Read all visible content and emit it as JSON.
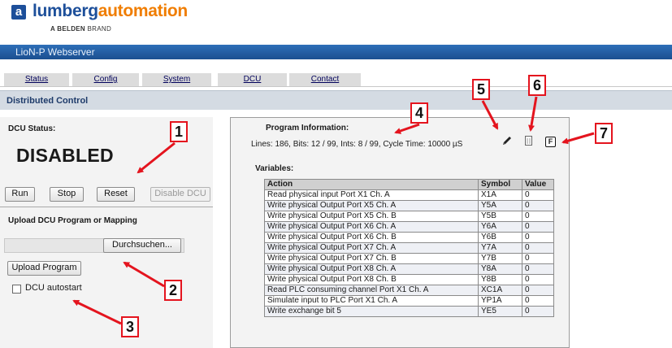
{
  "header": {
    "logo_letter": "a",
    "brand_part1": "lumberg",
    "brand_part2": "automation",
    "tagline_bold": "A BELDEN",
    "tagline_rest": " BRAND",
    "window_title": "LioN-P Webserver"
  },
  "nav": {
    "tabs": [
      {
        "label": "Status"
      },
      {
        "label": "Config"
      },
      {
        "label": "System"
      },
      {
        "label": "DCU"
      },
      {
        "label": "Contact"
      }
    ]
  },
  "section_title": "Distributed Control",
  "dcu": {
    "status_label": "DCU Status:",
    "status_value": "DISABLED",
    "buttons": {
      "run": "Run",
      "stop": "Stop",
      "reset": "Reset",
      "disable": "Disable DCU"
    },
    "upload_label": "Upload DCU Program or Mapping",
    "browse_button": "Durchsuchen...",
    "upload_button": "Upload Program",
    "autostart_label": "DCU autostart",
    "autostart_checked": false
  },
  "program": {
    "info_label": "Program Information:",
    "info_text": "Lines: 186, Bits: 12 / 99, Ints: 8 / 99, Cycle Time: 10000 µS",
    "icons": [
      "edit-pencil-icon",
      "document-icon",
      "f-icon"
    ],
    "f_icon_letter": "F",
    "variables_label": "Variables:",
    "columns": [
      "Action",
      "Symbol",
      "Value"
    ],
    "rows": [
      [
        "Read physical input Port X1 Ch. A",
        "X1A",
        "0"
      ],
      [
        "Write physical Output Port X5 Ch. A",
        "Y5A",
        "0"
      ],
      [
        "Write physical Output Port X5 Ch. B",
        "Y5B",
        "0"
      ],
      [
        "Write physical Output Port X6 Ch. A",
        "Y6A",
        "0"
      ],
      [
        "Write physical Output Port X6 Ch. B",
        "Y6B",
        "0"
      ],
      [
        "Write physical Output Port X7 Ch. A",
        "Y7A",
        "0"
      ],
      [
        "Write physical Output Port X7 Ch. B",
        "Y7B",
        "0"
      ],
      [
        "Write physical Output Port X8 Ch. A",
        "Y8A",
        "0"
      ],
      [
        "Write physical Output Port X8 Ch. B",
        "Y8B",
        "0"
      ],
      [
        "Read PLC consuming channel Port X1 Ch. A",
        "XC1A",
        "0"
      ],
      [
        "Simulate input to PLC Port X1 Ch. A",
        "YP1A",
        "0"
      ],
      [
        "Write exchange bit 5",
        "YE5",
        "0"
      ]
    ]
  },
  "annotations": {
    "callouts": [
      "1",
      "2",
      "3",
      "4",
      "5",
      "6",
      "7"
    ],
    "color": "#e4141e"
  },
  "colors": {
    "brand_blue": "#1d4f9a",
    "brand_orange": "#f07d00",
    "titlebar": "#1b4f90"
  }
}
